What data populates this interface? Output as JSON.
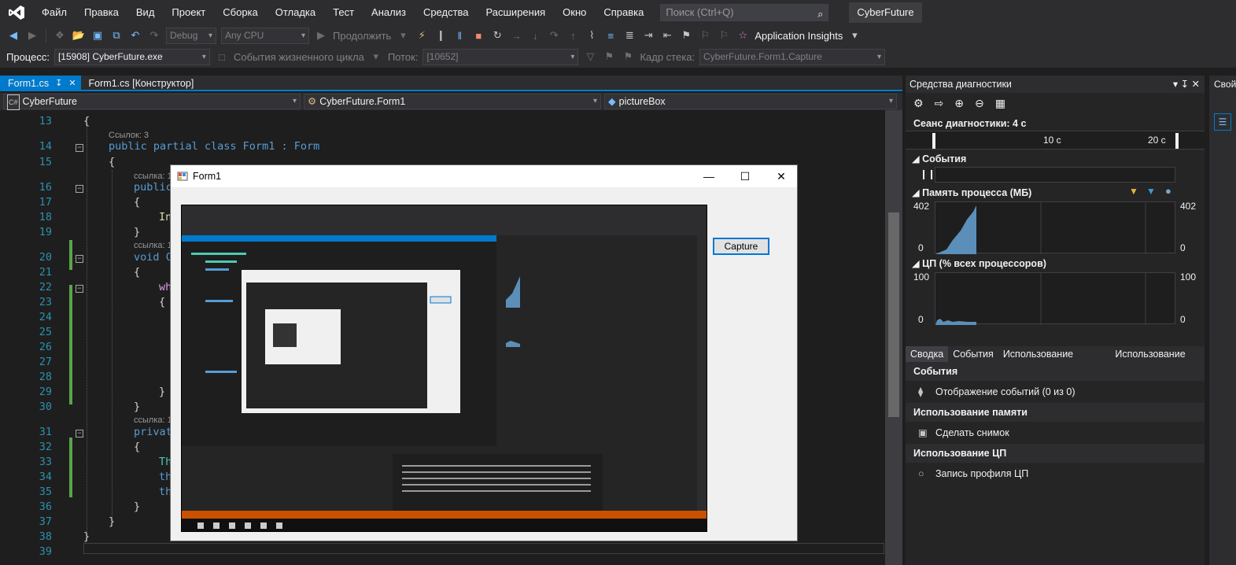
{
  "menu": [
    "Файл",
    "Правка",
    "Вид",
    "Проект",
    "Сборка",
    "Отладка",
    "Тест",
    "Анализ",
    "Средства",
    "Расширения",
    "Окно",
    "Справка"
  ],
  "search": {
    "placeholder": "Поиск (Ctrl+Q)"
  },
  "app_title": "CyberFuture",
  "toolbar": {
    "config": "Debug",
    "platform": "Any CPU",
    "continue_label": "Продолжить",
    "app_insights": "Application Insights"
  },
  "debug_bar": {
    "process_label": "Процесс:",
    "process_value": "[15908] CyberFuture.exe",
    "lifecycle": "События жизненного цикла",
    "thread_label": "Поток:",
    "thread_value": "[10652]",
    "stack_label": "Кадр стека:",
    "stack_value": "CyberFuture.Form1.Capture"
  },
  "tabs": [
    {
      "label": "Form1.cs",
      "active": true
    },
    {
      "label": "Form1.cs [Конструктор]",
      "active": false
    }
  ],
  "nav": {
    "project": "CyberFuture",
    "class": "CyberFuture.Form1",
    "member": "pictureBox"
  },
  "code": {
    "refs_3": "Ссылок: 3",
    "refs_1": "ссылка: 1",
    "lines": [
      {
        "n": "13",
        "t": "{"
      },
      {
        "n": "14",
        "t": "public partial class Form1 : Form"
      },
      {
        "n": "15",
        "t": "{"
      },
      {
        "n": "16",
        "t": "public"
      },
      {
        "n": "17",
        "t": "{"
      },
      {
        "n": "18",
        "t": "In"
      },
      {
        "n": "19",
        "t": "}"
      },
      {
        "n": "20",
        "t": "void C"
      },
      {
        "n": "21",
        "t": "{"
      },
      {
        "n": "22",
        "t": "wh"
      },
      {
        "n": "23",
        "t": "{"
      },
      {
        "n": "24",
        "t": ""
      },
      {
        "n": "25",
        "t": ""
      },
      {
        "n": "26",
        "t": ""
      },
      {
        "n": "27",
        "t": ""
      },
      {
        "n": "28",
        "t": ""
      },
      {
        "n": "29",
        "t": "}"
      },
      {
        "n": "30",
        "t": "}"
      },
      {
        "n": "31",
        "t": "privat"
      },
      {
        "n": "32",
        "t": "{"
      },
      {
        "n": "33",
        "t": "Th"
      },
      {
        "n": "34",
        "t": "th"
      },
      {
        "n": "35",
        "t": "th"
      },
      {
        "n": "36",
        "t": "}"
      },
      {
        "n": "37",
        "t": "}"
      },
      {
        "n": "38",
        "t": "}"
      },
      {
        "n": "39",
        "t": ""
      }
    ]
  },
  "form": {
    "title": "Form1",
    "capture_button": "Capture"
  },
  "diagnostics": {
    "title": "Средства диагностики",
    "session": "Сеанс диагностики: 4 с",
    "tl_10": "10 с",
    "tl_20": "20 с",
    "events_label": "События",
    "memory_label": "Память процесса (МБ)",
    "memory_max": "402",
    "memory_min": "0",
    "cpu_label": "ЦП (% всех процессоров)",
    "cpu_max": "100",
    "cpu_min": "0",
    "tabs": [
      "Сводка",
      "События",
      "Использование памяти",
      "Использование ЦП"
    ],
    "sect_events": "События",
    "show_events": "Отображение событий (0 из 0)",
    "sect_memory": "Использование памяти",
    "snapshot": "Сделать снимок",
    "sect_cpu": "Использование ЦП",
    "cpu_profile": "Запись профиля ЦП"
  },
  "right_dock": {
    "label": "Свой"
  },
  "colors": {
    "accent": "#007acc",
    "background": "#1e1e1e",
    "chart_fill": "#5b8fb9"
  }
}
